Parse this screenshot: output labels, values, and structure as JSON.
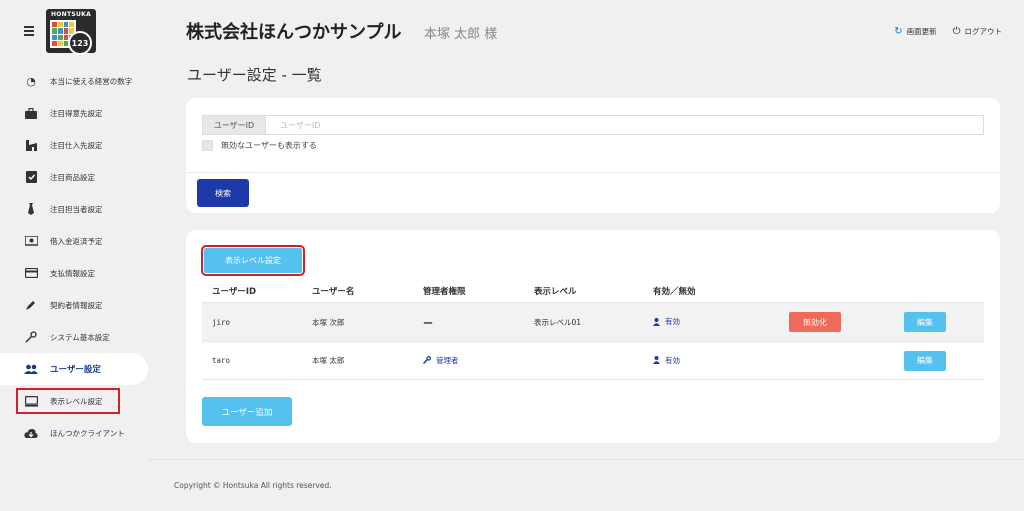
{
  "logo": {
    "text": "HONTSUKA",
    "badge": "123"
  },
  "sidebar": {
    "items": [
      {
        "label": "本当に使える経営の数字",
        "icon": "gauge-icon"
      },
      {
        "label": "注目得意先設定",
        "icon": "briefcase-icon"
      },
      {
        "label": "注目仕入先設定",
        "icon": "building-icon"
      },
      {
        "label": "注目商品設定",
        "icon": "checklist-icon"
      },
      {
        "label": "注目担当者設定",
        "icon": "necktie-icon"
      },
      {
        "label": "借入金返済予定",
        "icon": "money-icon"
      },
      {
        "label": "支払情報設定",
        "icon": "credit-card-icon"
      },
      {
        "label": "契約者情報設定",
        "icon": "pen-icon"
      },
      {
        "label": "システム基本設定",
        "icon": "wrench-icon"
      },
      {
        "label": "ユーザー設定",
        "icon": "users-icon"
      },
      {
        "label": "表示レベル設定",
        "icon": "monitor-icon"
      },
      {
        "label": "ほんつかクライアント",
        "icon": "cloud-download-icon"
      }
    ]
  },
  "header": {
    "company": "株式会社ほんつかサンプル",
    "user": "本塚 太郎 様",
    "refresh_label": "画面更新",
    "logout_label": "ログアウト"
  },
  "page_title": "ユーザー設定 - 一覧",
  "search": {
    "label": "ユーザーID",
    "placeholder": "ユーザーID",
    "checkbox_label": "無効なユーザーも表示する",
    "button": "検索"
  },
  "list": {
    "level_button": "表示レベル設定",
    "columns": [
      "ユーザーID",
      "ユーザー名",
      "管理者権限",
      "表示レベル",
      "有効／無効"
    ],
    "rows": [
      {
        "id": "jiro",
        "name": "本塚 次郎",
        "admin": "ー",
        "level": "表示レベル01",
        "status": "有効",
        "disable_button": "無効化",
        "edit_button": "編集"
      },
      {
        "id": "taro",
        "name": "本塚 太郎",
        "admin": "管理者",
        "level": "",
        "status": "有効",
        "disable_button": "",
        "edit_button": "編集"
      }
    ],
    "add_button": "ユーザー追加"
  },
  "footer": {
    "copyright": "Copyright © Hontsuka All rights reserved."
  },
  "colors": {
    "primary": "#1e3aa8",
    "accent": "#55c1ef",
    "danger": "#ef6a5b",
    "highlight": "#d0202a"
  }
}
